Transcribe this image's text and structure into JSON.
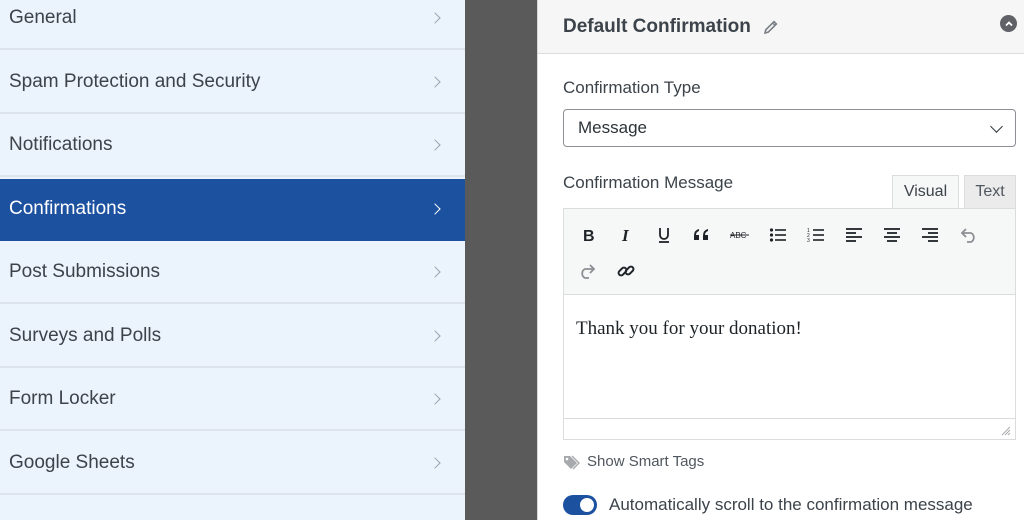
{
  "sidebar": {
    "items": [
      {
        "label": "General",
        "active": false
      },
      {
        "label": "Spam Protection and Security",
        "active": false
      },
      {
        "label": "Notifications",
        "active": false
      },
      {
        "label": "Confirmations",
        "active": true
      },
      {
        "label": "Post Submissions",
        "active": false
      },
      {
        "label": "Surveys and Polls",
        "active": false
      },
      {
        "label": "Form Locker",
        "active": false
      },
      {
        "label": "Google Sheets",
        "active": false
      }
    ]
  },
  "panel": {
    "title": "Default Confirmation",
    "confirmation_type_label": "Confirmation Type",
    "confirmation_type_value": "Message",
    "confirmation_message_label": "Confirmation Message",
    "tabs": {
      "visual": "Visual",
      "text": "Text"
    },
    "editor_content": "Thank you for your donation!",
    "smart_tags_label": "Show Smart Tags",
    "auto_scroll_label": "Automatically scroll to the confirmation message",
    "auto_scroll_enabled": true
  },
  "colors": {
    "accent": "#1c51a0",
    "sidebar_bg": "#ebf3fc",
    "gutter": "#5a5a5a"
  }
}
